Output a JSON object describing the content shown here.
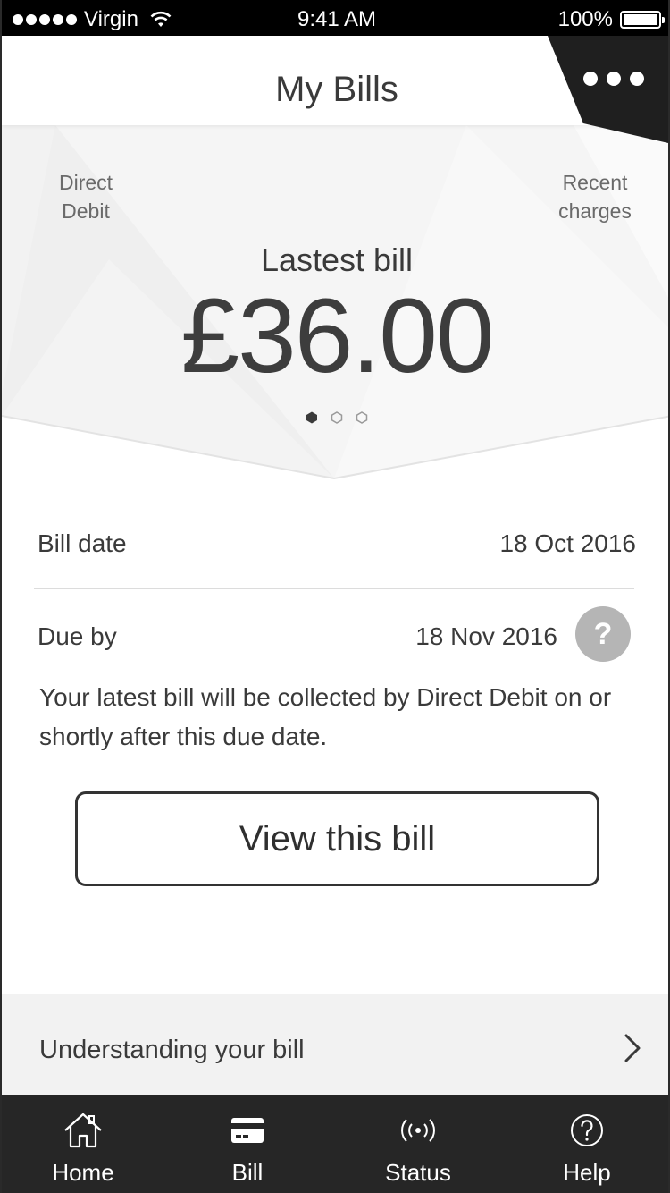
{
  "status_bar": {
    "carrier": "Virgin",
    "time": "9:41 AM",
    "battery": "100%"
  },
  "header": {
    "title": "My Bills"
  },
  "hero": {
    "left_link": [
      "Direct",
      "Debit"
    ],
    "right_link": [
      "Recent",
      "charges"
    ],
    "subtitle": "Lastest bill",
    "amount": "£36.00",
    "pager_active_index": 0,
    "pager_count": 3
  },
  "details": {
    "bill_date_label": "Bill date",
    "bill_date_value": "18 Oct 2016",
    "due_by_label": "Due by",
    "due_by_value": "18 Nov 2016",
    "info_text": "Your latest bill will be collected by Direct Debit on or shortly after this due date.",
    "help_badge": "?"
  },
  "actions": {
    "view_bill": "View this bill"
  },
  "understanding": {
    "label": "Understanding your bill"
  },
  "tabbar": {
    "tabs": [
      {
        "label": "Home",
        "icon": "home-icon"
      },
      {
        "label": "Bill",
        "icon": "credit-card-icon"
      },
      {
        "label": "Status",
        "icon": "broadcast-icon"
      },
      {
        "label": "Help",
        "icon": "help-circle-icon"
      }
    ]
  },
  "colors": {
    "tabbar_bg": "#262626",
    "text_primary": "#3a3a3a",
    "help_badge": "#b5b5b5"
  }
}
